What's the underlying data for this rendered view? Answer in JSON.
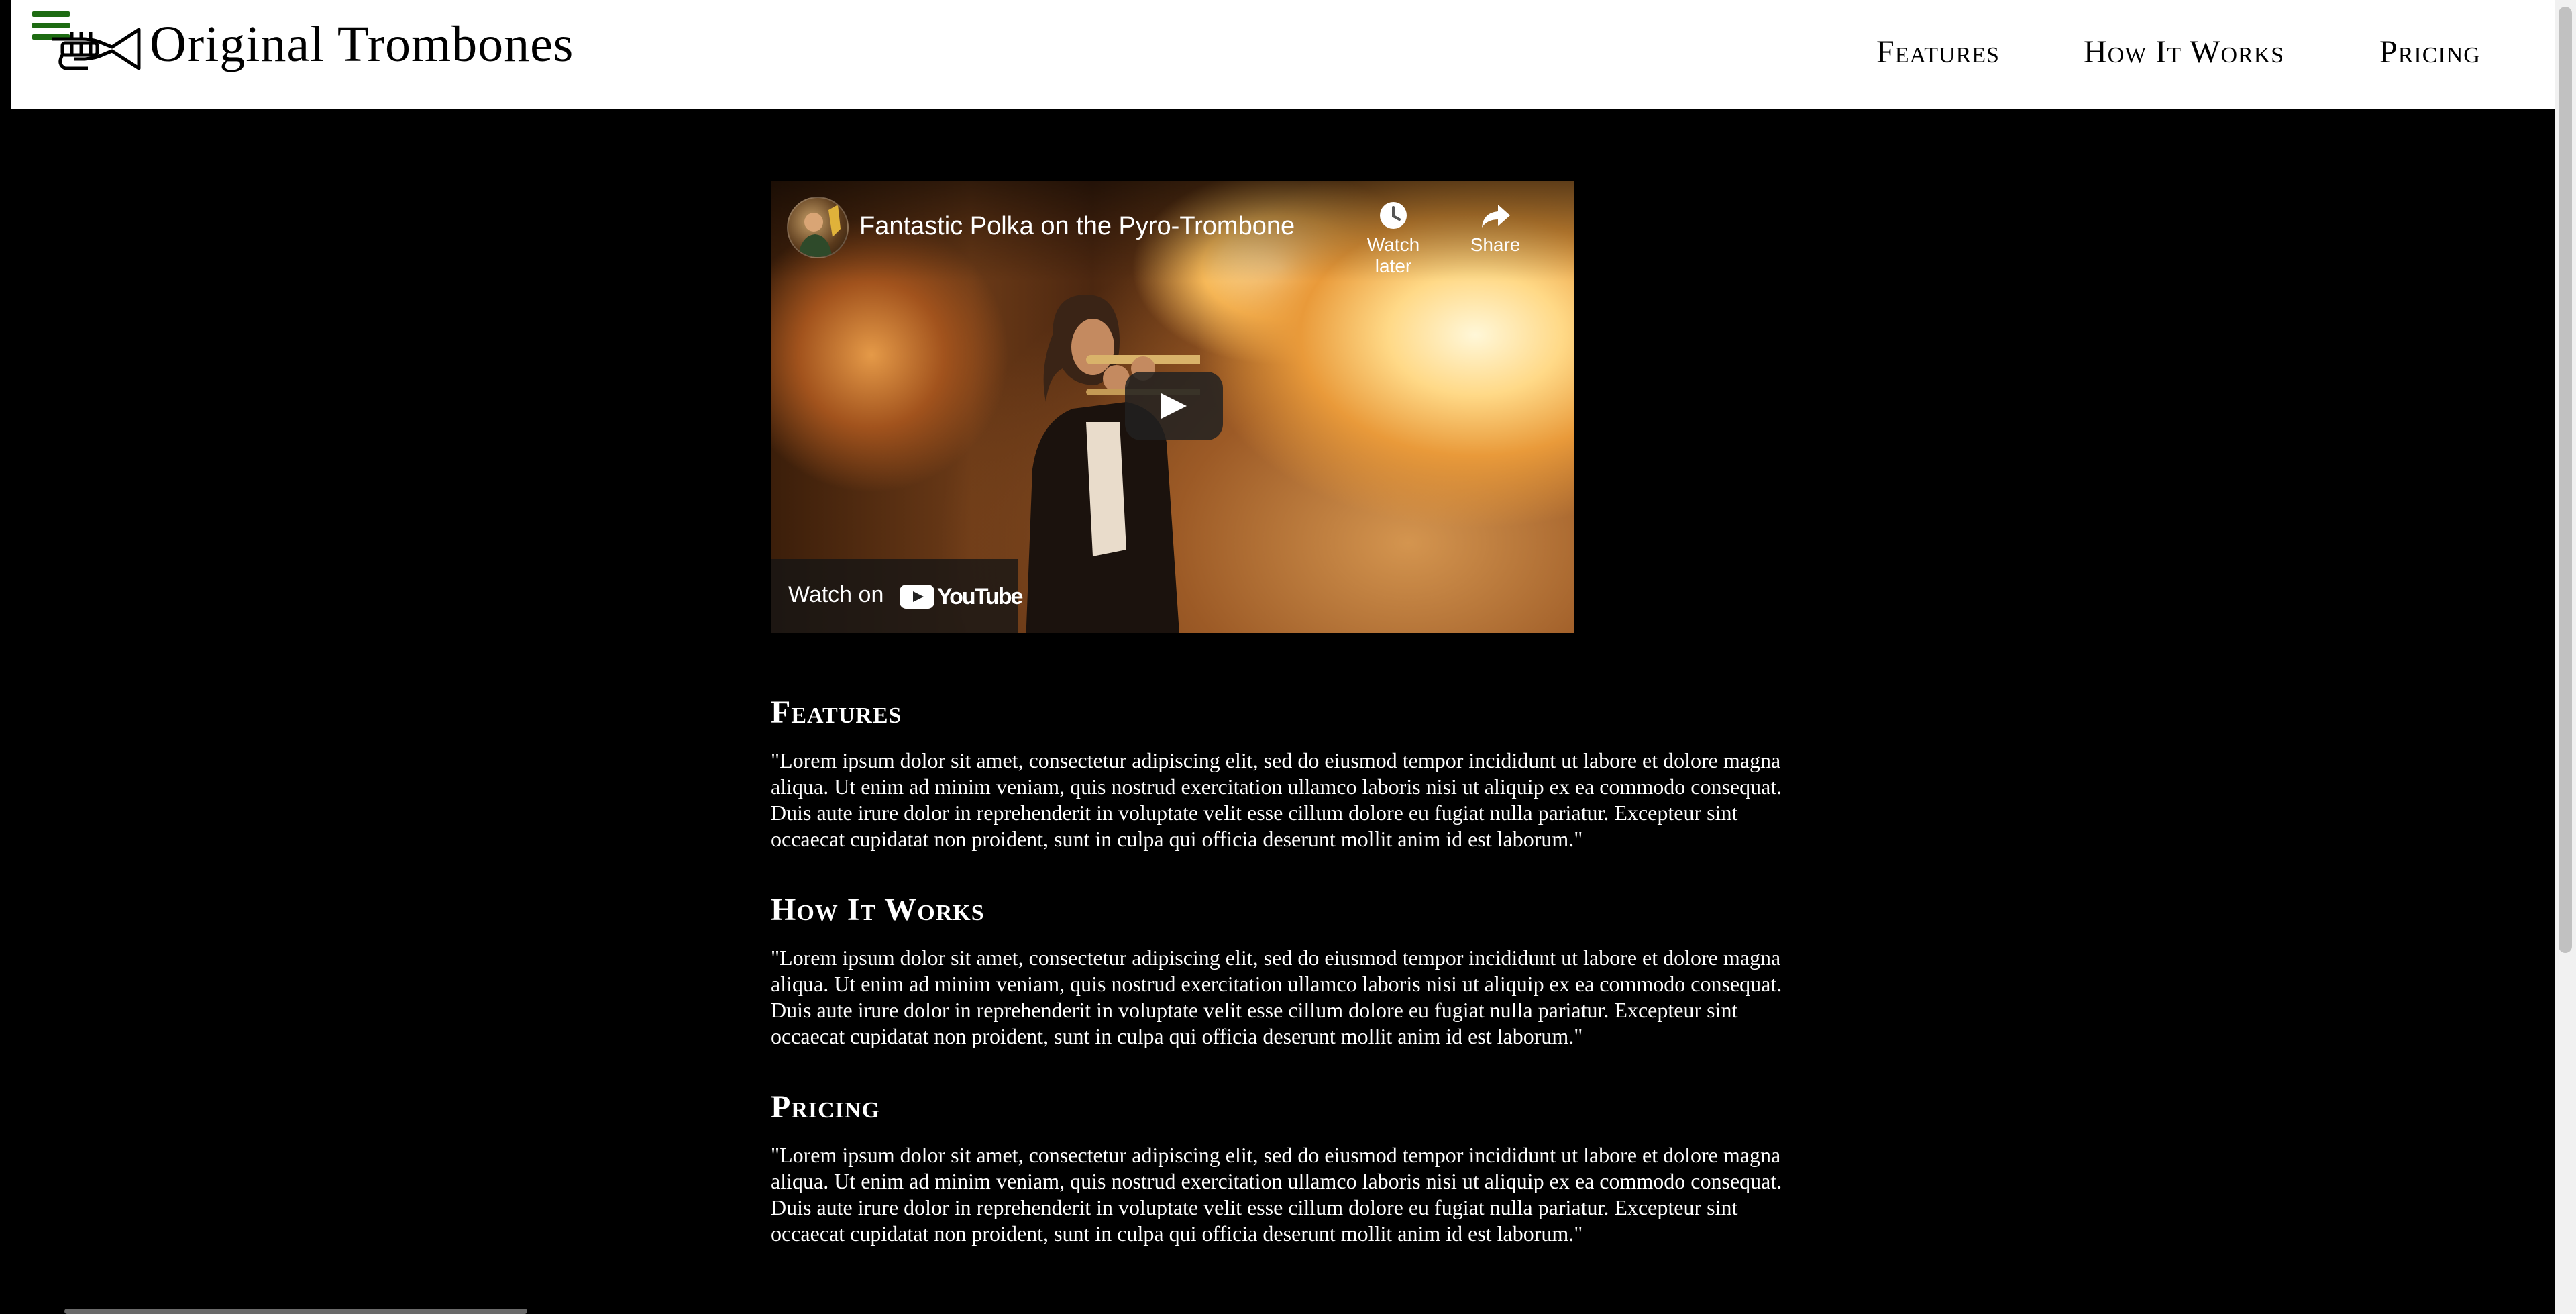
{
  "header": {
    "brand_title": "Original Trombones",
    "menu_icon": "hamburger-menu-icon",
    "logo_icon": "trumpet-icon",
    "nav": [
      {
        "label": "Features"
      },
      {
        "label": "How It Works"
      },
      {
        "label": "Pricing"
      }
    ]
  },
  "video": {
    "title": "Fantastic Polka on the Pyro-Trombone",
    "watch_later_label": "Watch later",
    "share_label": "Share",
    "watch_on_label": "Watch on",
    "youtube_label": "YouTube",
    "play_icon": "play-icon"
  },
  "sections": [
    {
      "heading": "Features",
      "body": "\"Lorem ipsum dolor sit amet, consectetur adipiscing elit, sed do eiusmod tempor incididunt ut labore et dolore magna aliqua. Ut enim ad minim veniam, quis nostrud exercitation ullamco laboris nisi ut aliquip ex ea commodo consequat. Duis aute irure dolor in reprehenderit in voluptate velit esse cillum dolore eu fugiat nulla pariatur. Excepteur sint occaecat cupidatat non proident, sunt in culpa qui officia deserunt mollit anim id est laborum.\""
    },
    {
      "heading": "How It Works",
      "body": "\"Lorem ipsum dolor sit amet, consectetur adipiscing elit, sed do eiusmod tempor incididunt ut labore et dolore magna aliqua. Ut enim ad minim veniam, quis nostrud exercitation ullamco laboris nisi ut aliquip ex ea commodo consequat. Duis aute irure dolor in reprehenderit in voluptate velit esse cillum dolore eu fugiat nulla pariatur. Excepteur sint occaecat cupidatat non proident, sunt in culpa qui officia deserunt mollit anim id est laborum.\""
    },
    {
      "heading": "Pricing",
      "body": "\"Lorem ipsum dolor sit amet, consectetur adipiscing elit, sed do eiusmod tempor incididunt ut labore et dolore magna aliqua. Ut enim ad minim veniam, quis nostrud exercitation ullamco laboris nisi ut aliquip ex ea commodo consequat. Duis aute irure dolor in reprehenderit in voluptate velit esse cillum dolore eu fugiat nulla pariatur. Excepteur sint occaecat cupidatat non proident, sunt in culpa qui officia deserunt mollit anim id est laborum.\""
    }
  ],
  "colors": {
    "page_background": "#000000",
    "header_background": "#ffffff",
    "menu_icon": "#1d6b12",
    "text_on_dark": "#ffffff"
  }
}
